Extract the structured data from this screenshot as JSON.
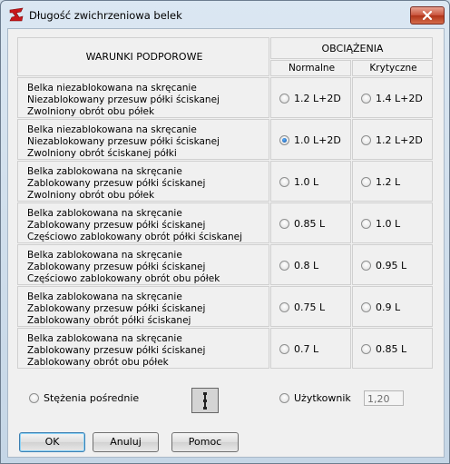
{
  "window": {
    "title": "Długość zwichrzeniowa belek"
  },
  "table": {
    "support_header": "WARUNKI PODPOROWE",
    "load_header": "OBCIĄŻENIA",
    "col_normal": "Normalne",
    "col_critical": "Krytyczne",
    "rows": [
      {
        "lines": [
          "Belka niezablokowana na skręcanie",
          "Niezablokowany przesuw półki ściskanej",
          "Zwolniony obrót obu półek"
        ],
        "normal": "1.2 L+2D",
        "critical": "1.4 L+2D",
        "normal_checked": false,
        "critical_checked": false
      },
      {
        "lines": [
          "Belka niezablokowana na skręcanie",
          "Niezablokowany przesuw półki ściskanej",
          "Zwolniony obrót ściskanej półki"
        ],
        "normal": "1.0 L+2D",
        "critical": "1.2 L+2D",
        "normal_checked": true,
        "critical_checked": false
      },
      {
        "lines": [
          "Belka zablokowana na skręcanie",
          "Zablokowany przesuw półki ściskanej",
          "Zwolniony obrót obu półek"
        ],
        "normal": "1.0 L",
        "critical": "1.2 L",
        "normal_checked": false,
        "critical_checked": false
      },
      {
        "lines": [
          "Belka zablokowana na skręcanie",
          "Zablokowany przesuw półki ściskanej",
          "Częściowo zablokowany obrót półki ściskanej"
        ],
        "normal": "0.85 L",
        "critical": "1.0 L",
        "normal_checked": false,
        "critical_checked": false
      },
      {
        "lines": [
          "Belka zablokowana na skręcanie",
          "Zablokowany przesuw półki ściskanej",
          "Częściowo zablokowany obrót obu półek"
        ],
        "normal": "0.8 L",
        "critical": "0.95 L",
        "normal_checked": false,
        "critical_checked": false
      },
      {
        "lines": [
          "Belka zablokowana na skręcanie",
          "Zablokowany przesuw półki ściskanej",
          "Zablokowany obrót półki ściskanej"
        ],
        "normal": "0.75 L",
        "critical": "0.9 L",
        "normal_checked": false,
        "critical_checked": false
      },
      {
        "lines": [
          "Belka zablokowana na skręcanie",
          "Zablokowany przesuw półki ściskanej",
          "Zablokowany obrót obu półek"
        ],
        "normal": "0.7 L",
        "critical": "0.85 L",
        "normal_checked": false,
        "critical_checked": false
      }
    ]
  },
  "bracing": {
    "label": "Stężenia pośrednie",
    "checked": false
  },
  "user": {
    "label": "Użytkownik",
    "value": "1,20",
    "checked": false
  },
  "buttons": {
    "ok": "OK",
    "cancel": "Anuluj",
    "help": "Pomoc"
  }
}
